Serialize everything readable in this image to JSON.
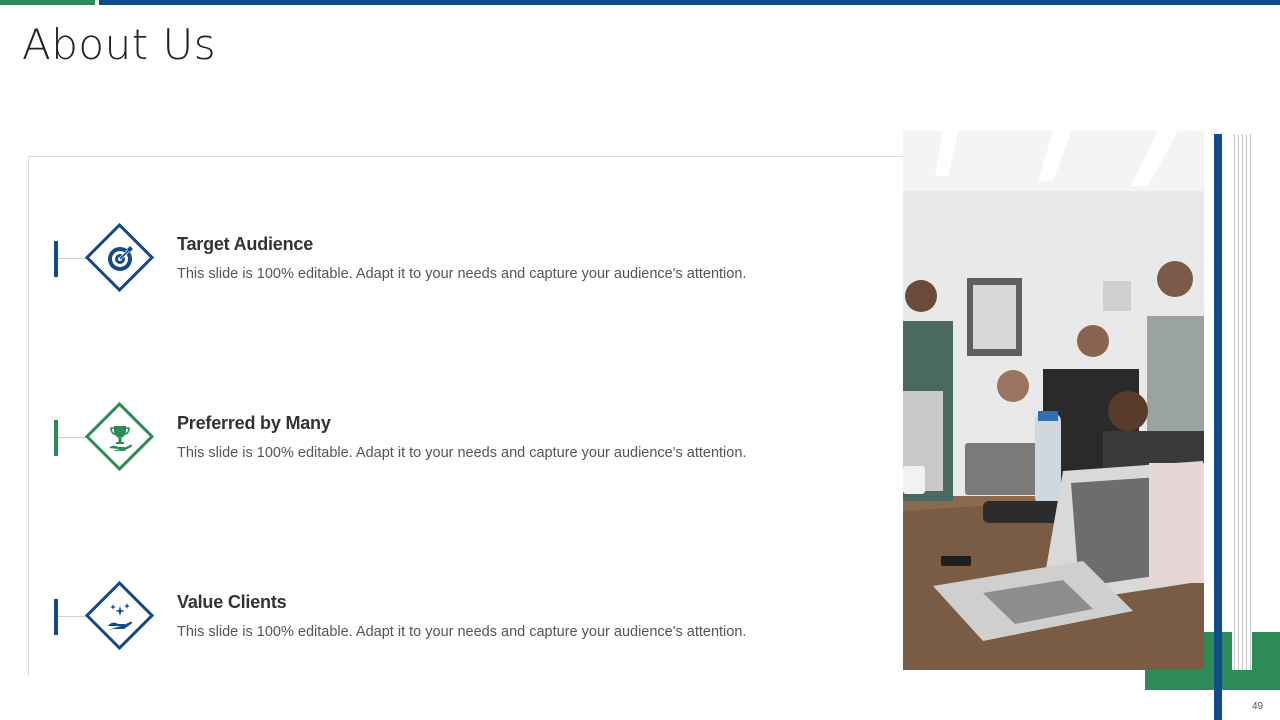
{
  "slide": {
    "title": "About Us",
    "page_number": "49",
    "colors": {
      "blue": "#134a8a",
      "green": "#2e8b57",
      "text": "#333333",
      "muted": "#555555"
    }
  },
  "items": [
    {
      "title": "Target Audience",
      "description": "This slide is 100% editable. Adapt it to your needs and capture your audience's attention.",
      "icon": "target-icon",
      "color": "#134a8a"
    },
    {
      "title": "Preferred by Many",
      "description": "This slide is 100% editable. Adapt it to your needs and capture your audience's attention.",
      "icon": "trophy-hand-icon",
      "color": "#2e8b57"
    },
    {
      "title": "Value Clients",
      "description": "This slide is 100% editable. Adapt it to your needs and capture your audience's attention.",
      "icon": "hand-sparkle-icon",
      "color": "#134a8a"
    }
  ]
}
